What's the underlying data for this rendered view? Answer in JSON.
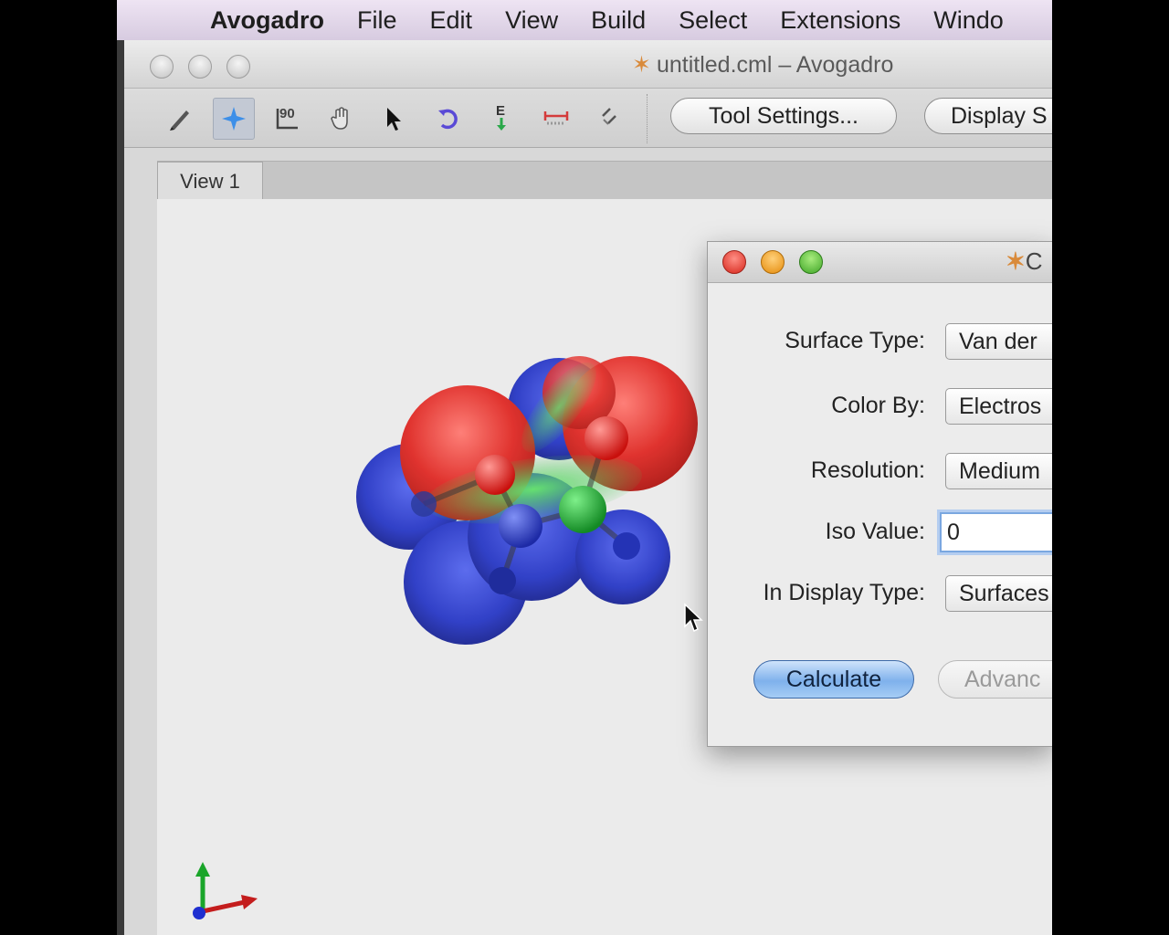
{
  "menubar": {
    "apple_glyph": "",
    "app_name": "Avogadro",
    "items": [
      "File",
      "Edit",
      "View",
      "Build",
      "Select",
      "Extensions",
      "Windo"
    ]
  },
  "window": {
    "title": "untitled.cml – Avogadro",
    "title_icon": "avogadro-star-icon"
  },
  "toolbar": {
    "tools": [
      {
        "name": "draw-tool-icon",
        "active": false
      },
      {
        "name": "navigate-tool-icon",
        "active": true
      },
      {
        "name": "bond-centric-tool-icon",
        "active": false
      },
      {
        "name": "manipulate-tool-icon",
        "active": false
      },
      {
        "name": "select-tool-icon",
        "active": false
      },
      {
        "name": "auto-rotate-tool-icon",
        "active": false
      },
      {
        "name": "auto-optimize-tool-icon",
        "active": false
      },
      {
        "name": "measure-tool-icon",
        "active": false
      },
      {
        "name": "align-tool-icon",
        "active": false
      }
    ],
    "bond_centric_text": "90",
    "auto_optimize_text": "E",
    "tool_settings_label": "Tool Settings...",
    "display_settings_label": "Display S"
  },
  "tabs": {
    "view1": "View 1"
  },
  "dialog": {
    "title_icon": "avogadro-star-icon",
    "title_visible": "C",
    "surface_type_label": "Surface Type:",
    "surface_type_value": "Van der",
    "color_by_label": "Color By:",
    "color_by_value": "Electros",
    "resolution_label": "Resolution:",
    "resolution_value": "Medium",
    "iso_value_label": "Iso Value:",
    "iso_value": "0",
    "display_type_label": "In Display Type:",
    "display_type_value": "Surfaces",
    "calculate_label": "Calculate",
    "advanced_label": "Advanc"
  },
  "colors": {
    "menubar": "#dcd0e6",
    "window_bg": "#d8d8d8",
    "viewport_bg": "#ebebeb",
    "negative_potential": "#e02020",
    "positive_potential": "#2233cc",
    "neutral_potential": "#22c033",
    "dialog_close": "#d6261b",
    "dialog_minimize": "#e58c0c",
    "dialog_zoom": "#3fa527",
    "calculate_accent": "#7fb1ec"
  }
}
